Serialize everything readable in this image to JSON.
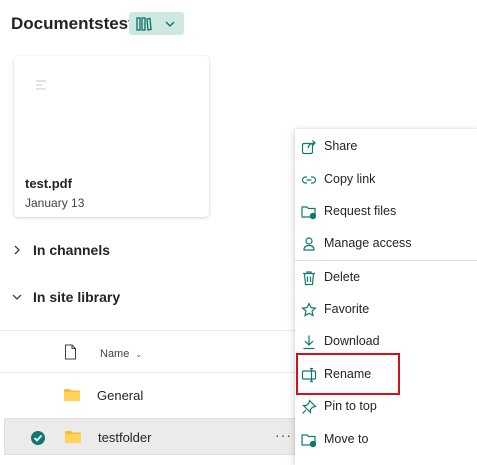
{
  "header": {
    "title": "Documentstest",
    "view_button": "library-view-icon"
  },
  "card": {
    "name": "test.pdf",
    "date": "January 13"
  },
  "sections": {
    "channels": "In channels",
    "site_library": "In site library"
  },
  "list": {
    "column_name": "Name",
    "rows": [
      {
        "name": "General",
        "selected": false
      },
      {
        "name": "testfolder",
        "selected": true,
        "more": "···"
      }
    ]
  },
  "menu": {
    "items": [
      {
        "label": "Share",
        "icon": "share-icon"
      },
      {
        "label": "Copy link",
        "icon": "link-icon"
      },
      {
        "label": "Request files",
        "icon": "request-files-icon"
      },
      {
        "label": "Manage access",
        "icon": "manage-access-icon"
      },
      {
        "label": "Delete",
        "icon": "delete-icon"
      },
      {
        "label": "Favorite",
        "icon": "star-icon"
      },
      {
        "label": "Download",
        "icon": "download-icon"
      },
      {
        "label": "Rename",
        "icon": "rename-icon"
      },
      {
        "label": "Pin to top",
        "icon": "pin-icon"
      },
      {
        "label": "Move to",
        "icon": "move-to-icon"
      }
    ]
  },
  "colors": {
    "accent": "#0e7a6f",
    "view_button_bg": "#cde8e1",
    "highlight": "#d1121b"
  }
}
